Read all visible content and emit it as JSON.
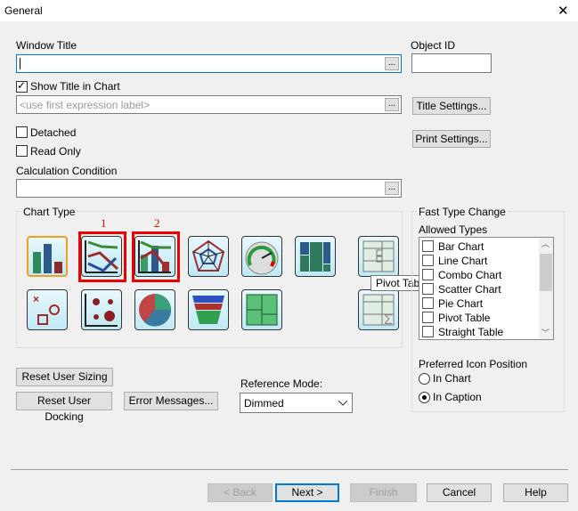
{
  "window": {
    "title": "General",
    "close": "✕"
  },
  "window_title": {
    "label": "Window Title",
    "value": "",
    "browse": "..."
  },
  "object_id": {
    "label": "Object ID",
    "value": ""
  },
  "show_title": {
    "label": "Show Title in Chart",
    "checked": true
  },
  "title_expr": {
    "placeholder": "<use first expression label>",
    "browse": "..."
  },
  "title_settings": "Title Settings...",
  "print_settings": "Print Settings...",
  "detached": {
    "label": "Detached"
  },
  "read_only": {
    "label": "Read Only"
  },
  "calc_condition": {
    "label": "Calculation Condition",
    "value": "",
    "browse": "..."
  },
  "chart_type": {
    "label": "Chart Type",
    "annotations": [
      "1",
      "2"
    ],
    "tooltip": "Pivot Table",
    "icons": [
      "bar-chart",
      "line-chart",
      "combo-chart",
      "radar-chart",
      "gauge-chart",
      "mekko-chart",
      "pivot-table",
      "scatter-chart",
      "grid-chart",
      "pie-chart",
      "funnel-chart",
      "block-chart",
      "straight-table"
    ]
  },
  "fast_type": {
    "label": "Fast Type Change",
    "allowed_label": "Allowed Types",
    "items": [
      "Bar Chart",
      "Line Chart",
      "Combo Chart",
      "Scatter Chart",
      "Pie Chart",
      "Pivot Table",
      "Straight Table"
    ],
    "icon_position_label": "Preferred Icon Position",
    "in_chart": "In Chart",
    "in_caption": "In Caption"
  },
  "reset_sizing": "Reset User Sizing",
  "reset_docking": "Reset User Docking",
  "error_messages": "Error Messages...",
  "reference_mode": {
    "label": "Reference Mode:",
    "value": "Dimmed"
  },
  "footer": {
    "back": "< Back",
    "next": "Next >",
    "finish": "Finish",
    "cancel": "Cancel",
    "help": "Help"
  }
}
